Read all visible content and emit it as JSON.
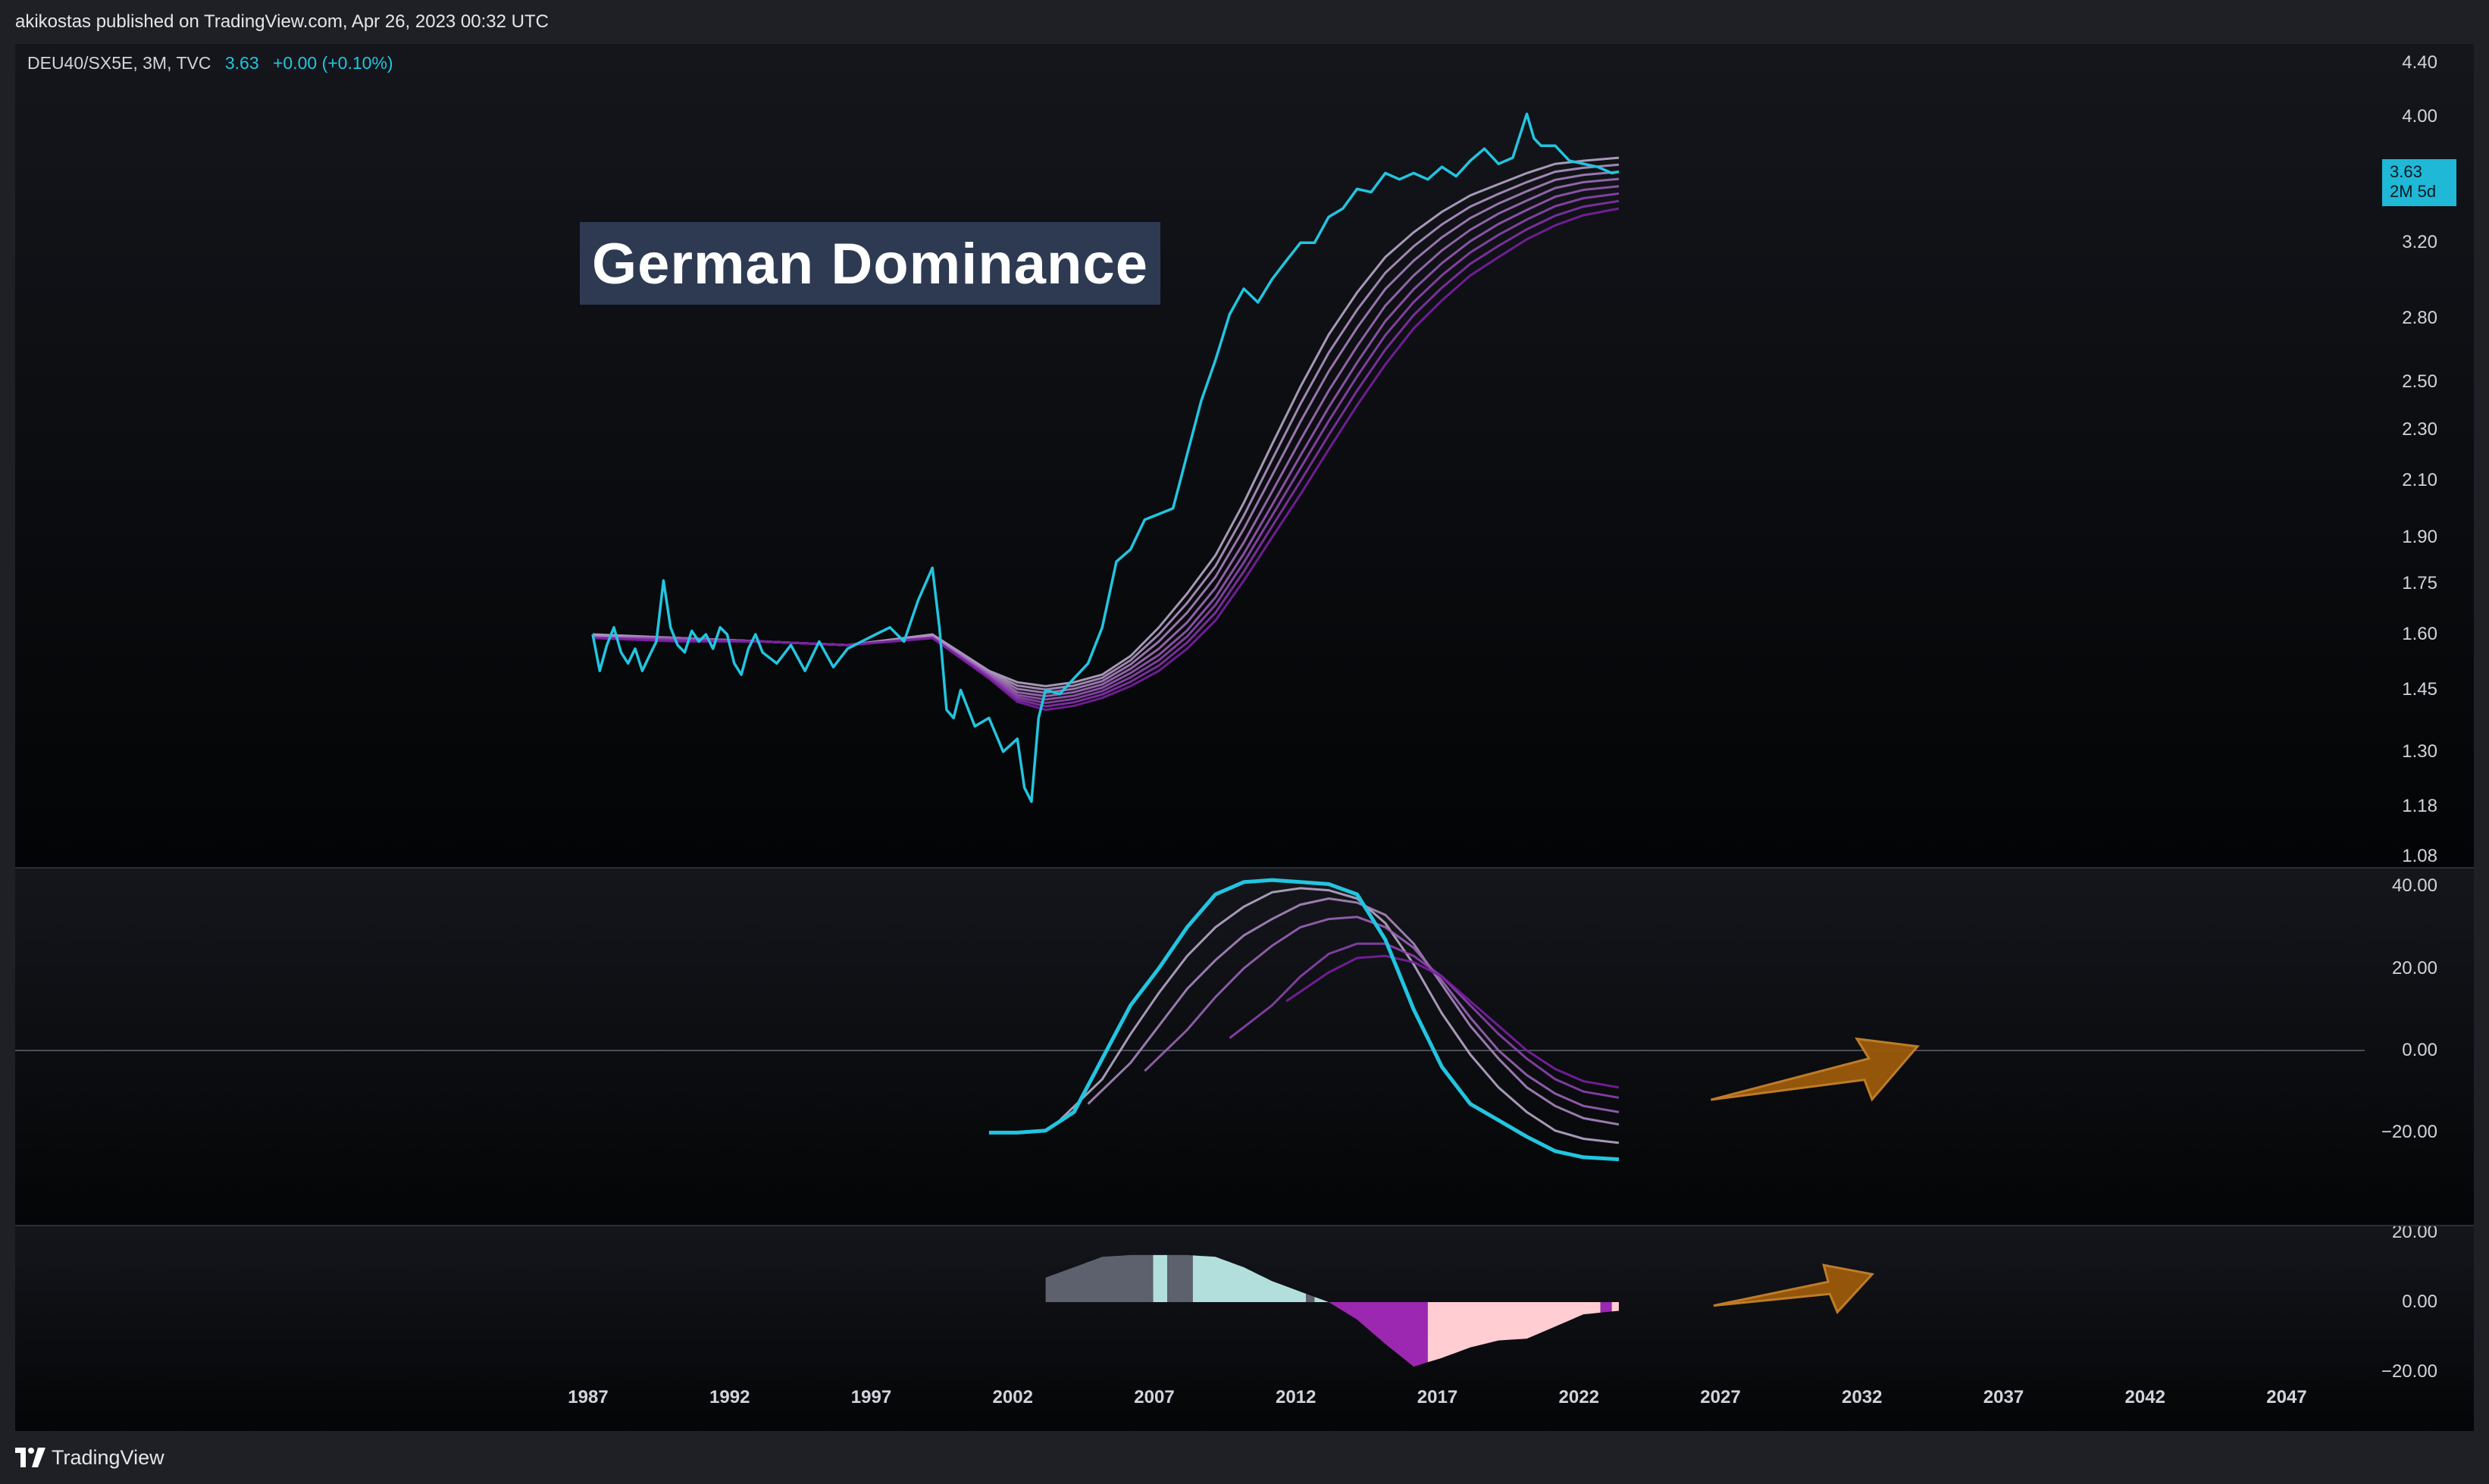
{
  "header": {
    "text": "akikostas published on TradingView.com, Apr 26, 2023 00:32 UTC"
  },
  "legend": {
    "symbol": "DEU40/SX5E, 3M, TVC",
    "value": "3.63",
    "change": "+0.00 (+0.10%)"
  },
  "annotation": {
    "title": "German Dominance"
  },
  "price_tag": {
    "value": "3.63",
    "countdown": "2M 5d"
  },
  "footer": {
    "brand": "TradingView"
  },
  "colors": {
    "price": "#22c5e0",
    "ribbon_light": "#b9a9c9",
    "ribbon_dark": "#7b1fa2",
    "arrow": "#9c5a0a",
    "hist_grey": "#5d616d",
    "hist_teal": "#b2dfdb",
    "hist_purple": "#9c27b0",
    "hist_pink": "#ffcdd2"
  },
  "chart_data": [
    {
      "type": "line",
      "scale": "log",
      "series": [
        {
          "x": [
            1987.0,
            1987.25,
            1987.5,
            1987.75,
            1988.0,
            1988.25,
            1988.5,
            1988.75,
            1989.0,
            1989.25,
            1989.5,
            1989.75,
            1990.0,
            1990.25,
            1990.5,
            1990.75,
            1991.0,
            1991.25,
            1991.5,
            1991.75,
            1992.0,
            1992.25,
            1992.5,
            1992.75,
            1993.0,
            1993.5,
            1994.0,
            1994.5,
            1995.0,
            1995.5,
            1996.0,
            1996.5,
            1997.0,
            1997.5,
            1998.0,
            1998.5,
            1999.0,
            1999.25,
            1999.5,
            1999.75,
            2000.0,
            2000.5,
            2001.0,
            2001.5,
            2002.0,
            2002.25,
            2002.5,
            2002.75,
            2003.0,
            2003.5,
            2004.0,
            2004.5,
            2005.0,
            2005.5,
            2006.0,
            2006.5,
            2007.0,
            2007.5,
            2008.0,
            2008.5,
            2009.0,
            2009.5,
            2010.0,
            2010.5,
            2011.0,
            2011.5,
            2012.0,
            2012.5,
            2013.0,
            2013.5,
            2014.0,
            2014.5,
            2015.0,
            2015.5,
            2016.0,
            2016.5,
            2017.0,
            2017.5,
            2018.0,
            2018.5,
            2019.0,
            2019.5,
            2020.0,
            2020.25,
            2020.5,
            2021.0,
            2021.5,
            2022.0,
            2022.5,
            2023.0,
            2023.25
          ],
          "values": [
            1.6,
            1.5,
            1.57,
            1.62,
            1.55,
            1.52,
            1.56,
            1.5,
            1.54,
            1.58,
            1.76,
            1.62,
            1.57,
            1.55,
            1.61,
            1.58,
            1.6,
            1.56,
            1.62,
            1.6,
            1.52,
            1.49,
            1.56,
            1.6,
            1.55,
            1.52,
            1.57,
            1.5,
            1.58,
            1.51,
            1.56,
            1.58,
            1.6,
            1.62,
            1.58,
            1.7,
            1.8,
            1.62,
            1.4,
            1.38,
            1.45,
            1.36,
            1.38,
            1.3,
            1.33,
            1.22,
            1.19,
            1.38,
            1.45,
            1.44,
            1.48,
            1.52,
            1.62,
            1.82,
            1.86,
            1.96,
            1.98,
            2.0,
            2.2,
            2.42,
            2.6,
            2.82,
            2.95,
            2.88,
            3.0,
            3.1,
            3.2,
            3.2,
            3.35,
            3.4,
            3.52,
            3.5,
            3.62,
            3.58,
            3.62,
            3.58,
            3.66,
            3.6,
            3.7,
            3.78,
            3.68,
            3.72,
            4.02,
            3.85,
            3.8,
            3.8,
            3.7,
            3.68,
            3.66,
            3.62,
            3.63
          ]
        },
        {
          "x": [
            1987,
            1990,
            1993,
            1996,
            1999,
            2001,
            2002,
            2003,
            2004,
            2005,
            2006,
            2007,
            2008,
            2009,
            2010,
            2011,
            2012,
            2013,
            2014,
            2015,
            2016,
            2017,
            2018,
            2019,
            2020,
            2021,
            2022,
            2023.25
          ],
          "values": [
            1.6,
            1.59,
            1.58,
            1.57,
            1.6,
            1.5,
            1.47,
            1.46,
            1.47,
            1.49,
            1.54,
            1.62,
            1.72,
            1.84,
            2.02,
            2.24,
            2.48,
            2.72,
            2.93,
            3.12,
            3.26,
            3.38,
            3.48,
            3.55,
            3.62,
            3.68,
            3.7,
            3.72
          ]
        },
        {
          "x": [
            1987,
            1990,
            1993,
            1996,
            1999,
            2001,
            2002,
            2003,
            2004,
            2005,
            2006,
            2007,
            2008,
            2009,
            2010,
            2011,
            2012,
            2013,
            2014,
            2015,
            2016,
            2017,
            2018,
            2019,
            2020,
            2021,
            2022,
            2023.25
          ],
          "values": [
            1.59,
            1.59,
            1.58,
            1.57,
            1.59,
            1.49,
            1.44,
            1.43,
            1.44,
            1.46,
            1.5,
            1.55,
            1.62,
            1.72,
            1.86,
            2.03,
            2.22,
            2.42,
            2.62,
            2.82,
            2.98,
            3.12,
            3.24,
            3.34,
            3.42,
            3.5,
            3.54,
            3.56
          ]
        },
        {
          "x": [
            1987,
            1990,
            1993,
            1996,
            1999,
            2001,
            2002,
            2003,
            2004,
            2005,
            2006,
            2007,
            2008,
            2009,
            2010,
            2011,
            2012,
            2013,
            2014,
            2015,
            2016,
            2017,
            2018,
            2019,
            2020,
            2021,
            2022,
            2023.25
          ],
          "values": [
            1.59,
            1.58,
            1.58,
            1.57,
            1.59,
            1.48,
            1.42,
            1.4,
            1.41,
            1.43,
            1.46,
            1.5,
            1.56,
            1.64,
            1.76,
            1.9,
            2.05,
            2.22,
            2.4,
            2.58,
            2.75,
            2.89,
            3.02,
            3.12,
            3.22,
            3.3,
            3.36,
            3.4
          ]
        }
      ]
    },
    {
      "type": "line",
      "ylim": [
        -28,
        48
      ],
      "series": [
        {
          "x": [
            2001,
            2002,
            2003,
            2004,
            2005,
            2006,
            2007,
            2008,
            2009,
            2010,
            2011,
            2012,
            2013,
            2014,
            2015,
            2016,
            2017,
            2018,
            2019,
            2020,
            2021,
            2022,
            2023.25
          ],
          "values": [
            -20,
            -20,
            -19.5,
            -15,
            -2,
            11,
            20,
            30,
            38,
            41,
            41.5,
            41,
            40.5,
            38,
            27,
            10,
            -4,
            -13,
            -17,
            -21,
            -24.5,
            -26,
            -26.5
          ]
        },
        {
          "x": [
            2003.5,
            2005,
            2006,
            2007,
            2008,
            2009,
            2010,
            2011,
            2012,
            2013,
            2014,
            2015,
            2016,
            2017,
            2018,
            2019,
            2020,
            2021,
            2022,
            2023.25
          ],
          "values": [
            -17,
            -7,
            4,
            14,
            23,
            30,
            35,
            38.5,
            39.5,
            39,
            37,
            31,
            21,
            9,
            -1,
            -9,
            -15,
            -19.5,
            -21.5,
            -22.5
          ]
        },
        {
          "x": [
            2004.5,
            2006,
            2007,
            2008,
            2009,
            2010,
            2011,
            2012,
            2013,
            2014,
            2015,
            2016,
            2017,
            2018,
            2019,
            2020,
            2021,
            2022,
            2023.25
          ],
          "values": [
            -13,
            -3,
            6,
            15,
            22,
            28,
            32,
            35.5,
            37,
            36,
            33,
            26,
            16,
            6,
            -2,
            -9,
            -13.5,
            -16.5,
            -18
          ]
        },
        {
          "x": [
            2006.5,
            2008,
            2009,
            2010,
            2011,
            2012,
            2013,
            2014,
            2015,
            2016,
            2017,
            2018,
            2019,
            2020,
            2021,
            2022,
            2023.25
          ],
          "values": [
            -5,
            5,
            13,
            20,
            25.5,
            30,
            32,
            32.5,
            30,
            25,
            17,
            8,
            0,
            -6,
            -10.5,
            -13.5,
            -15
          ]
        },
        {
          "x": [
            2009.5,
            2011,
            2012,
            2013,
            2014,
            2015,
            2016,
            2017,
            2018,
            2019,
            2020,
            2021,
            2022,
            2023.25
          ],
          "values": [
            3,
            11,
            18,
            23.5,
            26,
            26,
            23,
            18,
            11,
            4,
            -2,
            -7,
            -10,
            -11.5
          ]
        },
        {
          "x": [
            2011.5,
            2013,
            2014,
            2015,
            2016,
            2017,
            2018,
            2019,
            2020,
            2021,
            2022,
            2023.25
          ],
          "values": [
            12,
            19,
            22.5,
            23,
            21.5,
            18,
            12,
            6,
            0,
            -4.5,
            -7.5,
            -9
          ]
        }
      ]
    },
    {
      "type": "area",
      "ylim": [
        -24,
        24
      ],
      "x": [
        2003,
        2004,
        2005,
        2006,
        2007,
        2008,
        2009,
        2010,
        2011,
        2012,
        2013,
        2014,
        2015,
        2016,
        2017,
        2018,
        2019,
        2020,
        2021,
        2022,
        2023.25
      ],
      "values": [
        7,
        10,
        13,
        13.5,
        13.5,
        13.5,
        13,
        10,
        6,
        3,
        0,
        -5,
        -12,
        -18.5,
        -16,
        -13,
        -11,
        -10.5,
        -7,
        -3.5,
        -2.5
      ]
    }
  ],
  "y_axis_price": [
    "4.40",
    "4.00",
    "3.63",
    "3.20",
    "2.80",
    "2.50",
    "2.30",
    "2.10",
    "1.90",
    "1.75",
    "1.60",
    "1.45",
    "1.30",
    "1.18",
    "1.08"
  ],
  "y_axis_osc": [
    "40.00",
    "20.00",
    "0.00",
    "−20.00"
  ],
  "y_axis_hist": [
    "20.00",
    "0.00",
    "−20.00"
  ],
  "x_axis": [
    "1987",
    "1992",
    "1997",
    "2002",
    "2007",
    "2012",
    "2017",
    "2022",
    "2027",
    "2032",
    "2037",
    "2042",
    "2047"
  ]
}
